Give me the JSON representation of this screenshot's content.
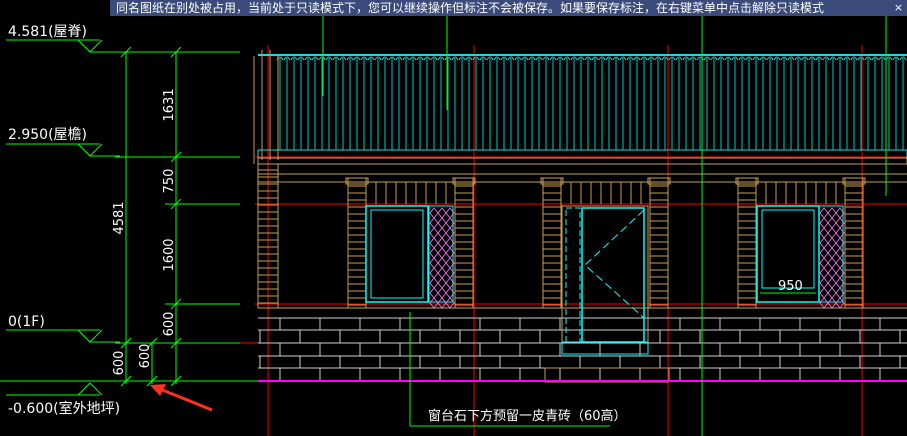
{
  "banner": {
    "message": "同名图纸在别处被占用，当前处于只读模式下，您可以继续操作但标注不会被保存。如果要保存标注，在右键菜单中点击解除只读模式",
    "close_label": "×"
  },
  "levels": {
    "ridge": "4.581(屋脊)",
    "eave": "2.950(屋檐)",
    "floor": "0(1F)",
    "ground": "-0.600(室外地坪)"
  },
  "dims": {
    "total": "4581",
    "seg_roof": "1631",
    "seg_top": "750",
    "seg_window": "1600",
    "seg_sill": "600",
    "base_a": "600",
    "base_b": "600",
    "window_width": "950"
  },
  "note": {
    "text": "窗台石下方预留一皮青砖（60高）"
  },
  "colors": {
    "dim_line": "#00ff00",
    "grid_red": "#ff0000",
    "cyan": "#00ffff",
    "brick": "#c8a050",
    "roof_tile": "#00e5e5",
    "ground_line": "#ff00ff",
    "arrow": "#ff3020"
  }
}
